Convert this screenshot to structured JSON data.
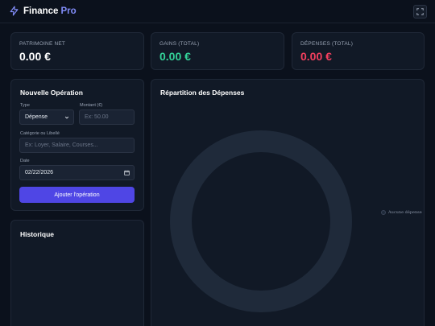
{
  "header": {
    "brand_name": "Finance",
    "brand_suffix": "Pro",
    "brand_icon": "lightning-icon",
    "fullscreen_icon": "expand-icon"
  },
  "stats": [
    {
      "label": "PATRIMOINE NET",
      "value": "0.00 €",
      "color": "#ffffff"
    },
    {
      "label": "GAINS (TOTAL)",
      "value": "0.00 €",
      "color": "#34d399"
    },
    {
      "label": "DÉPENSES (TOTAL)",
      "value": "0.00 €",
      "color": "#f43f5e"
    }
  ],
  "form": {
    "title": "Nouvelle Opération",
    "type_label": "Type",
    "type_value": "Dépense",
    "amount_label": "Montant (€)",
    "amount_placeholder": "Ex: 50.00",
    "category_label": "Catégorie ou Libellé",
    "category_placeholder": "Ex: Loyer, Salaire, Courses...",
    "date_label": "Date",
    "date_value": "02/22/2026",
    "submit_label": "Ajouter l'opération"
  },
  "history": {
    "title": "Historique"
  },
  "chart": {
    "title": "Répartition des Dépenses",
    "legend_text": "Aucune dépense"
  },
  "chart_data": {
    "type": "pie",
    "categories": [
      "Aucune dépense"
    ],
    "values": [
      1
    ],
    "legend_position": "right"
  },
  "colors": {
    "accent": "#4f46e5",
    "positive": "#34d399",
    "negative": "#f43f5e",
    "empty_ring": "#1f2a3a"
  }
}
